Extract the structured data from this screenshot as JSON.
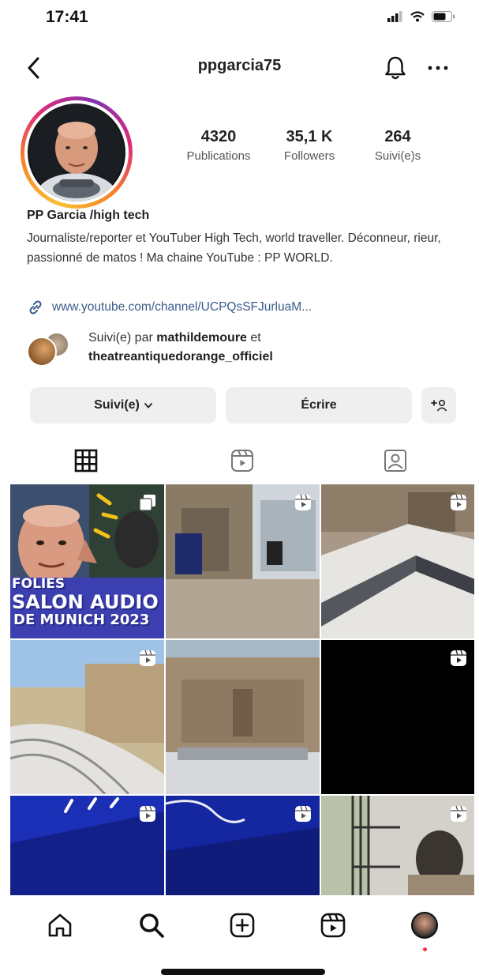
{
  "status_bar": {
    "time": "17:41"
  },
  "header": {
    "username": "ppgarcia75"
  },
  "profile": {
    "stats": [
      {
        "value": "4320",
        "label": "Publications"
      },
      {
        "value": "35,1 K",
        "label": "Followers"
      },
      {
        "value": "264",
        "label": "Suivi(e)s"
      }
    ],
    "name": "PP Garcia /high tech",
    "bio": "Journaliste/reporter et YouTuber High Tech, world traveller. Déconneur, rieur, passionné de matos ! Ma chaine YouTube : PP WORLD.",
    "link": "www.youtube.com/channel/UCPQsSFJurluaM...",
    "followed_by_prefix": "Suivi(e) par",
    "followed_by_user1": "mathildemoure",
    "followed_by_joiner": "et",
    "followed_by_user2": "theatreantiquedorange_officiel"
  },
  "actions": {
    "following_label": "Suivi(e)",
    "message_label": "Écrire"
  },
  "posts": [
    {
      "kind": "thumbnail",
      "overlay_lines": [
        "FOLIES",
        "SALON AUDIO",
        "DE MUNICH 2023"
      ],
      "badge": "carousel-icon"
    },
    {
      "kind": "photo",
      "badge": "reels-icon"
    },
    {
      "kind": "photo",
      "badge": "reels-icon"
    },
    {
      "kind": "photo",
      "badge": "reels-icon"
    },
    {
      "kind": "photo",
      "badge": "none"
    },
    {
      "kind": "black",
      "badge": "reels-icon"
    },
    {
      "kind": "blue",
      "badge": "reels-icon"
    },
    {
      "kind": "blue",
      "badge": "reels-icon"
    },
    {
      "kind": "photo",
      "badge": "reels-icon"
    }
  ],
  "colors": {
    "ring_start": "#f9c031",
    "ring_end": "#dd2a7b",
    "link": "#3a5a8a",
    "button_bg": "#efefef",
    "notification_dot": "#ff3040"
  }
}
